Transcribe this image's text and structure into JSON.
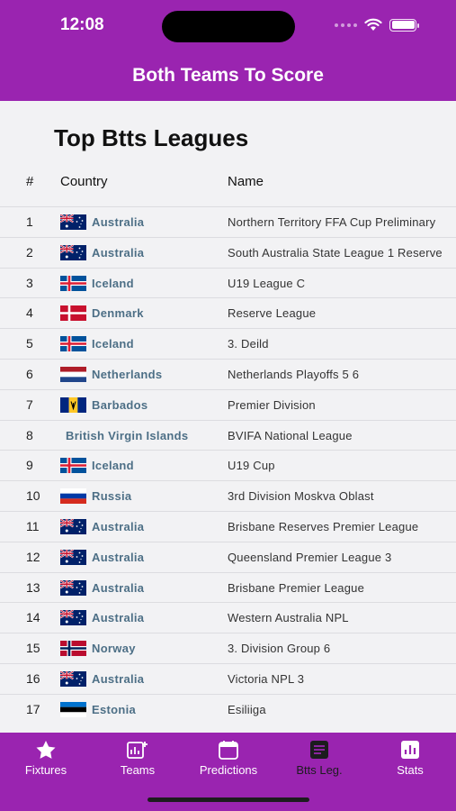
{
  "status": {
    "time": "12:08"
  },
  "header": {
    "title": "Both Teams To Score"
  },
  "page": {
    "title": "Top Btts Leagues"
  },
  "table": {
    "headers": {
      "rank": "#",
      "country": "Country",
      "name": "Name"
    },
    "rows": [
      {
        "rank": "1",
        "country": "Australia",
        "flag": "australia",
        "name": "Northern Territory FFA Cup Preliminary"
      },
      {
        "rank": "2",
        "country": "Australia",
        "flag": "australia",
        "name": "South Australia State League 1 Reserve"
      },
      {
        "rank": "3",
        "country": "Iceland",
        "flag": "iceland",
        "name": "U19 League C"
      },
      {
        "rank": "4",
        "country": "Denmark",
        "flag": "denmark",
        "name": "Reserve League"
      },
      {
        "rank": "5",
        "country": "Iceland",
        "flag": "iceland",
        "name": "3. Deild"
      },
      {
        "rank": "6",
        "country": "Netherlands",
        "flag": "netherlands",
        "name": "Netherlands Playoffs 5 6"
      },
      {
        "rank": "7",
        "country": "Barbados",
        "flag": "barbados",
        "name": "Premier Division"
      },
      {
        "rank": "8",
        "country": "British Virgin Islands",
        "flag": "",
        "name": "BVIFA National League"
      },
      {
        "rank": "9",
        "country": "Iceland",
        "flag": "iceland",
        "name": "U19 Cup"
      },
      {
        "rank": "10",
        "country": "Russia",
        "flag": "russia",
        "name": "3rd Division Moskva Oblast"
      },
      {
        "rank": "11",
        "country": "Australia",
        "flag": "australia",
        "name": "Brisbane Reserves Premier League"
      },
      {
        "rank": "12",
        "country": "Australia",
        "flag": "australia",
        "name": "Queensland Premier League 3"
      },
      {
        "rank": "13",
        "country": "Australia",
        "flag": "australia",
        "name": "Brisbane Premier League"
      },
      {
        "rank": "14",
        "country": "Australia",
        "flag": "australia",
        "name": "Western Australia NPL"
      },
      {
        "rank": "15",
        "country": "Norway",
        "flag": "norway",
        "name": "3. Division Group 6"
      },
      {
        "rank": "16",
        "country": "Australia",
        "flag": "australia",
        "name": "Victoria NPL 3"
      },
      {
        "rank": "17",
        "country": "Estonia",
        "flag": "estonia",
        "name": "Esiliiga"
      }
    ]
  },
  "tabs": [
    {
      "label": "Fixtures",
      "icon": "star-icon",
      "active": false
    },
    {
      "label": "Teams",
      "icon": "chart-plus-icon",
      "active": false
    },
    {
      "label": "Predictions",
      "icon": "calendar-icon",
      "active": false
    },
    {
      "label": "Btts Leg.",
      "icon": "list-icon",
      "active": true
    },
    {
      "label": "Stats",
      "icon": "bar-chart-icon",
      "active": false
    }
  ],
  "colors": {
    "primary": "#9a24b0",
    "country_link": "#4d6f86",
    "active_tab": "#1c1c1e"
  }
}
